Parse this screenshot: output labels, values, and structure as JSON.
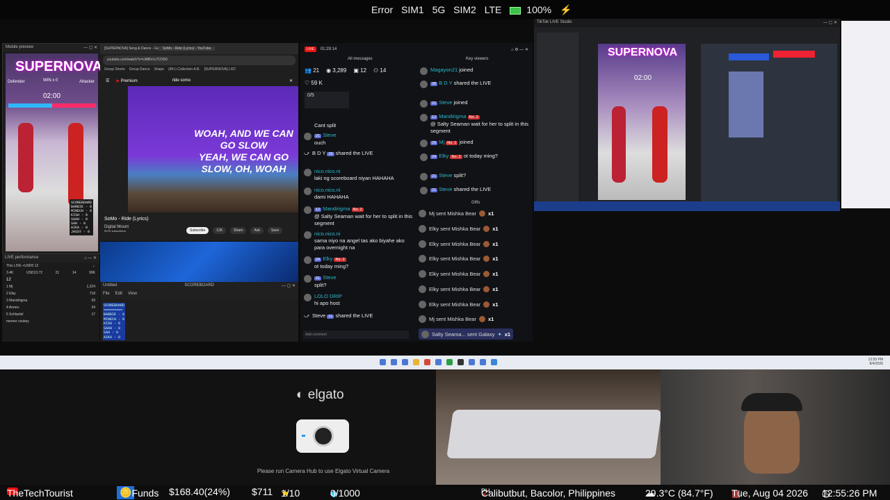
{
  "status_bar": {
    "error": "Error",
    "sim1": "SIM1",
    "net1": "5G",
    "sim2": "SIM2",
    "net2": "LTE",
    "battery": "100%"
  },
  "mobile_preview": {
    "title": "Mobile preview",
    "banner": "SUPERNOVA",
    "timer": "02:00",
    "win_label": "WIN x 0",
    "left_label": "Defender",
    "right_label": "Attacker",
    "scoreboard": [
      "SCOREBOARD",
      "BARBIE - 0",
      "MINECH - 0",
      "KISH - 0",
      "SAAH - 0",
      "SAH - 0",
      "AIKA - 0",
      "JASSY - 0"
    ]
  },
  "live_performance": {
    "title": "LIVE performance",
    "live_row": "This LIVE +USD0.12",
    "stats": [
      "3.4K",
      "USD13.72",
      "21",
      "14",
      "99K"
    ],
    "rank_count": "12",
    "rows": [
      {
        "rank": "1",
        "name": "Mj",
        "score": "1,224"
      },
      {
        "rank": "2",
        "name": "Elky",
        "score": "718"
      },
      {
        "rank": "3",
        "name": "Mandirigma",
        "score": "59"
      },
      {
        "rank": "4",
        "name": "Anneo",
        "score": "34"
      },
      {
        "rank": "5",
        "name": "Schlanlel",
        "score": "17"
      },
      {
        "rank": "",
        "name": "memer cookey",
        "score": ""
      }
    ]
  },
  "browser": {
    "tabs": [
      "[SUPERNOVA] Song & Dance - Goo",
      "SoMo - Ride (Lyrics) - YouTube"
    ],
    "url": "youtube.com/watch?v=UMBVcUTZX50",
    "bookmarks": [
      "Group Shorts",
      "Group Dance",
      "Shape",
      "(99+) Collection A.B.",
      "[SUPERNOVA] LIST"
    ],
    "yt_brand": "Premium",
    "search": "ride somo",
    "lyric1": "WOAH, AND WE CAN GO SLOW",
    "lyric2": "YEAH, WE CAN GO SLOW, OH, WOAH",
    "video_title": "SoMo - Ride (Lyrics)",
    "channel": "Digital Mount",
    "subscribers": "997K subscribers",
    "subscribe": "Subscribe",
    "likes": "12K",
    "share": "Share",
    "ask": "Ask",
    "save": "Save"
  },
  "editor": {
    "title": "Untitled",
    "doc": "SCOREBOARD",
    "menu": [
      "File",
      "Edit",
      "View"
    ],
    "lines": [
      "SCOREBOARD",
      "=========",
      "BARBIE - 0",
      "MINECH - 0",
      "KISH - 0",
      "SAAH - 0",
      "SAH - 0",
      "AIKA - 0",
      "JASSY - 0"
    ]
  },
  "chat": {
    "live": "LIVE",
    "time": "01:29:14",
    "all_messages": "All messages",
    "key_viewers": "Key viewers",
    "gifts_title": "Gifts",
    "stats": {
      "viewers": "21",
      "views": "3,289",
      "shares": "12",
      "follows": "14",
      "likes": "59 K"
    },
    "progress": "0/5",
    "add_comment": "Add comment",
    "messages": [
      {
        "user": "",
        "text": "Cant split"
      },
      {
        "user": "Steve",
        "badge": "21",
        "text": "ouch"
      },
      {
        "user": "B      D      Y",
        "badge": "28",
        "text": "shared the LIVE"
      },
      {
        "user": "nico.nico.ni",
        "text": "laki ng scoreboard niyan HAHAHA"
      },
      {
        "user": "nico.nico.ni",
        "text": "dami HAHAHA"
      },
      {
        "user": "Mandirigma",
        "badge": "12",
        "rank": "No. 2",
        "text": "@ Salty Seaman wait for her to split in this segment"
      },
      {
        "user": "nico.nico.ni",
        "text": "sama niyo na angel tas ako biyahe ako para overnight na"
      },
      {
        "user": "Elky",
        "badge": "24",
        "rank": "No. 2",
        "text": "ot today ming?"
      },
      {
        "user": "Steve",
        "badge": "21",
        "text": "split?"
      },
      {
        "user": "LOLO DRIP",
        "text": "hi apo host"
      },
      {
        "user": "Steve",
        "badge": "21",
        "text": "shared the LIVE"
      }
    ],
    "key_messages": [
      {
        "user": "Magayon21",
        "text": "joined"
      },
      {
        "user": "B      D      Y",
        "badge": "28",
        "text": "shared the LIVE"
      },
      {
        "user": "Steve",
        "badge": "21",
        "text": "joined"
      },
      {
        "user": "Mandirigma",
        "badge": "12",
        "rank": "No. 2",
        "text": "@ Salty Seaman wait for her to split in this segment"
      },
      {
        "user": "Mj",
        "badge": "29",
        "rank": "No. 1",
        "text": "joined"
      },
      {
        "user": "Elky",
        "badge": "24",
        "rank": "No. 2",
        "text": "ot today ming?"
      },
      {
        "user": "Steve",
        "badge": "21",
        "text": "split?"
      },
      {
        "user": "Steve",
        "badge": "21",
        "text": "shared the LIVE"
      }
    ],
    "gifts": [
      {
        "text": "Mj sent Mishka Bear",
        "count": "x1"
      },
      {
        "text": "Elky sent Mishka Bear",
        "count": "x1"
      },
      {
        "text": "Elky sent Mishka Bear",
        "count": "x1"
      },
      {
        "text": "Elky sent Mishka Bear",
        "count": "x1"
      },
      {
        "text": "Elky sent Mishka Bear",
        "count": "x1"
      },
      {
        "text": "Elky sent Mishka Bear",
        "count": "x1"
      },
      {
        "text": "Elky sent Mishka Bear",
        "count": "x1"
      },
      {
        "text": "Mj sent Mishka Bear",
        "count": "x1"
      },
      {
        "text": "Salty Seama...  sent Galaxy",
        "count": "x1"
      }
    ]
  },
  "studio": {
    "title": "TikTok LIVE Studio",
    "banner": "SUPERNOVA",
    "timer": "02:00"
  },
  "taskbar": {
    "time": "12:55 PM",
    "date": "8/4/2026"
  },
  "elgato": {
    "logo": "elgato",
    "hint": "Please run Camera Hub to use Elgato Virtual Camera"
  },
  "bottom_bar": {
    "channel": "TheTechTourist",
    "funds": "Funds",
    "money": "$168.40(24%)",
    "money2": "$711",
    "stars": "1/10",
    "gems": "0/1000",
    "location": "Calibutbut, Bacolor, Philippines",
    "country": "PH",
    "weather": "29.3°C (84.7°F)",
    "date": "Tue, Aug 04 2026",
    "time": "12:55:26 PM"
  }
}
